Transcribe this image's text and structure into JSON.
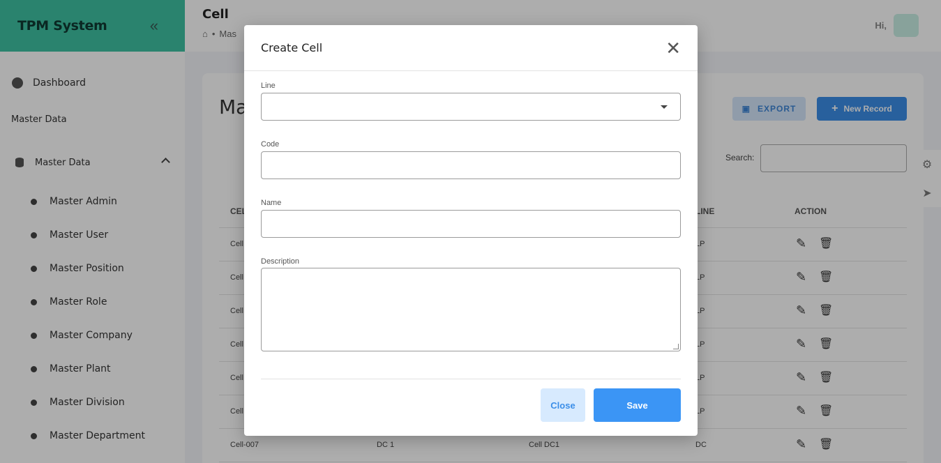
{
  "sidebar": {
    "brand": "TPM System",
    "collapse_icon": "double-chevron-left-icon",
    "dashboard": "Dashboard",
    "section_label": "Master Data",
    "group_label": "Master Data",
    "items": [
      {
        "label": "Master Admin"
      },
      {
        "label": "Master User"
      },
      {
        "label": "Master Position"
      },
      {
        "label": "Master Role"
      },
      {
        "label": "Master Company"
      },
      {
        "label": "Master Plant"
      },
      {
        "label": "Master Division"
      },
      {
        "label": "Master Department"
      }
    ]
  },
  "topbar": {
    "title": "Cell",
    "breadcrumb": "Mas",
    "greeting": "Hi,"
  },
  "card": {
    "title": "Ma",
    "export_label": "EXPORT",
    "new_label": "New Record",
    "search_label": "Search:",
    "columns": [
      "CEL",
      "LINE",
      "ACTION"
    ],
    "rows": [
      {
        "code": "Cell",
        "line": "LP"
      },
      {
        "code": "Cell",
        "line": "LP"
      },
      {
        "code": "Cell",
        "line": "LP"
      },
      {
        "code": "Cell",
        "line": "LP"
      },
      {
        "code": "Cell",
        "line": "LP"
      },
      {
        "code": "Cell",
        "line": "LP"
      },
      {
        "code": "Cell-007",
        "division": "DC 1",
        "name": "Cell DC1",
        "line": "DC"
      }
    ]
  },
  "modal": {
    "title": "Create Cell",
    "fields": {
      "line": {
        "label": "Line",
        "value": ""
      },
      "code": {
        "label": "Code",
        "value": ""
      },
      "name": {
        "label": "Name",
        "value": ""
      },
      "description": {
        "label": "Description",
        "value": ""
      }
    },
    "close_label": "Close",
    "save_label": "Save"
  },
  "colors": {
    "brand": "#3ec2a2",
    "primary": "#3b8ee8",
    "primary_light": "#d7eafe"
  }
}
